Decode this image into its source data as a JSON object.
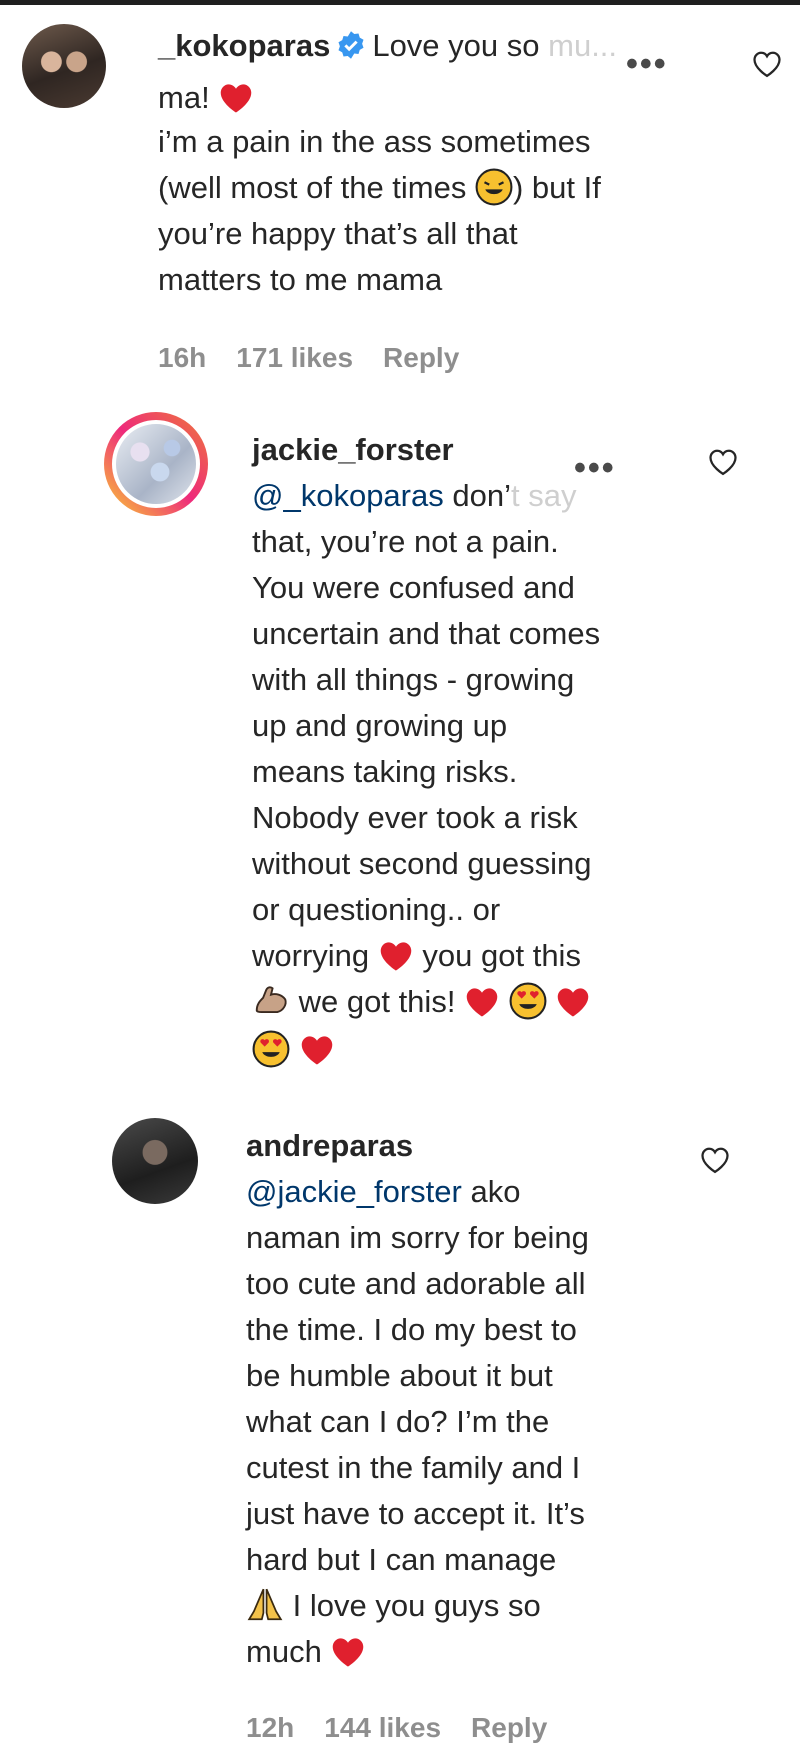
{
  "comments": [
    {
      "username": "_kokoparas",
      "verified": true,
      "lines": [
        "Love you so",
        "mu...",
        "ma!",
        "i’m a pain in the ass sometimes",
        "(well most of the times",
        ") but If",
        "you’re happy that’s all that",
        "matters to me mama"
      ],
      "time": "16h",
      "likes": "171 likes",
      "reply_label": "Reply"
    },
    {
      "username": "jackie_forster",
      "mention": "@_kokoparas",
      "lines": [
        "don’",
        "t say",
        "that, you’re not a pain.",
        "You were confused and",
        "uncertain and that comes",
        "with all things - growing",
        "up and growing up",
        "means taking risks.",
        "Nobody ever took a risk",
        "without second guessing",
        "or questioning.. or",
        "worrying",
        "you got this",
        "we got this!"
      ]
    },
    {
      "username": "andreparas",
      "mention": "@jackie_forster",
      "lines": [
        "ako",
        "naman im sorry for being",
        "too cute and adorable all",
        "the time. I do my best to",
        "be humble about it but",
        "what can I do? I’m the",
        "cutest in the family and I",
        "just have to accept it. It’s",
        "hard but I can manage",
        "I love you guys so",
        "much"
      ],
      "time": "12h",
      "likes": "144 likes",
      "reply_label": "Reply"
    }
  ],
  "icons": {
    "more": "more-options-icon",
    "like": "heart-outline-icon",
    "verified": "verified-badge-icon"
  },
  "colors": {
    "text": "#262626",
    "meta": "#8e8e8e",
    "mention": "#00376b",
    "heart_emoji": "#e0202e",
    "verified_blue": "#3897f0"
  }
}
